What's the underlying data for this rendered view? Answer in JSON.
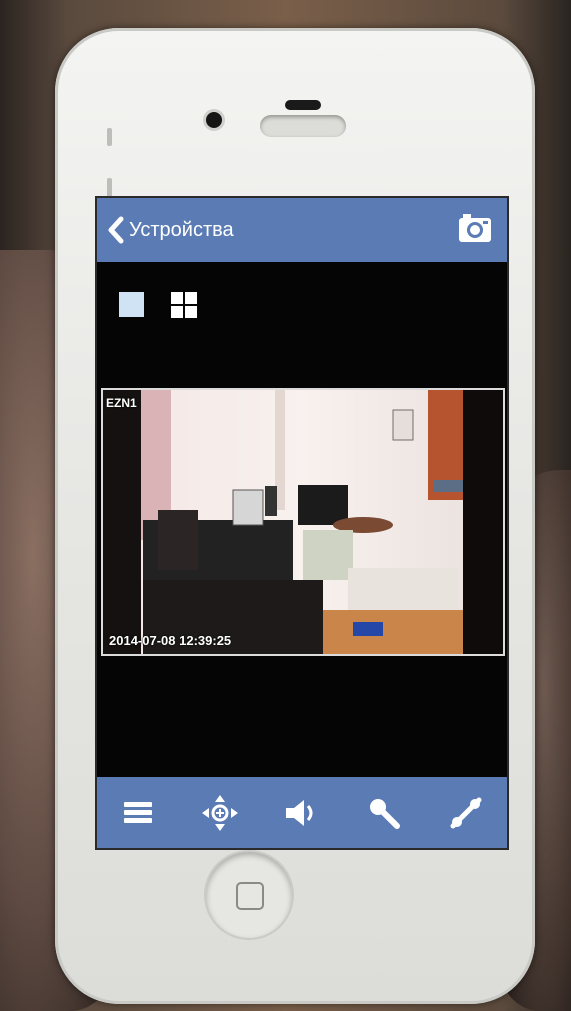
{
  "app": {
    "nav": {
      "back_label": "Устройства",
      "back_icon": "chevron-left-icon",
      "snapshot_icon": "camera-icon"
    },
    "layout_buttons": [
      {
        "name": "single-view-icon",
        "selected": true
      },
      {
        "name": "quad-view-icon",
        "selected": false
      }
    ],
    "video": {
      "camera_name": "EZN1",
      "timestamp": "2014-07-08 12:39:25"
    },
    "toolbar": [
      {
        "icon": "menu-icon"
      },
      {
        "icon": "ptz-control-icon"
      },
      {
        "icon": "speaker-icon"
      },
      {
        "icon": "microphone-icon"
      },
      {
        "icon": "record-icon"
      }
    ],
    "colors": {
      "accent": "#5b7bb4",
      "background": "#060505",
      "selected_layout": "#cfe3f5"
    }
  }
}
